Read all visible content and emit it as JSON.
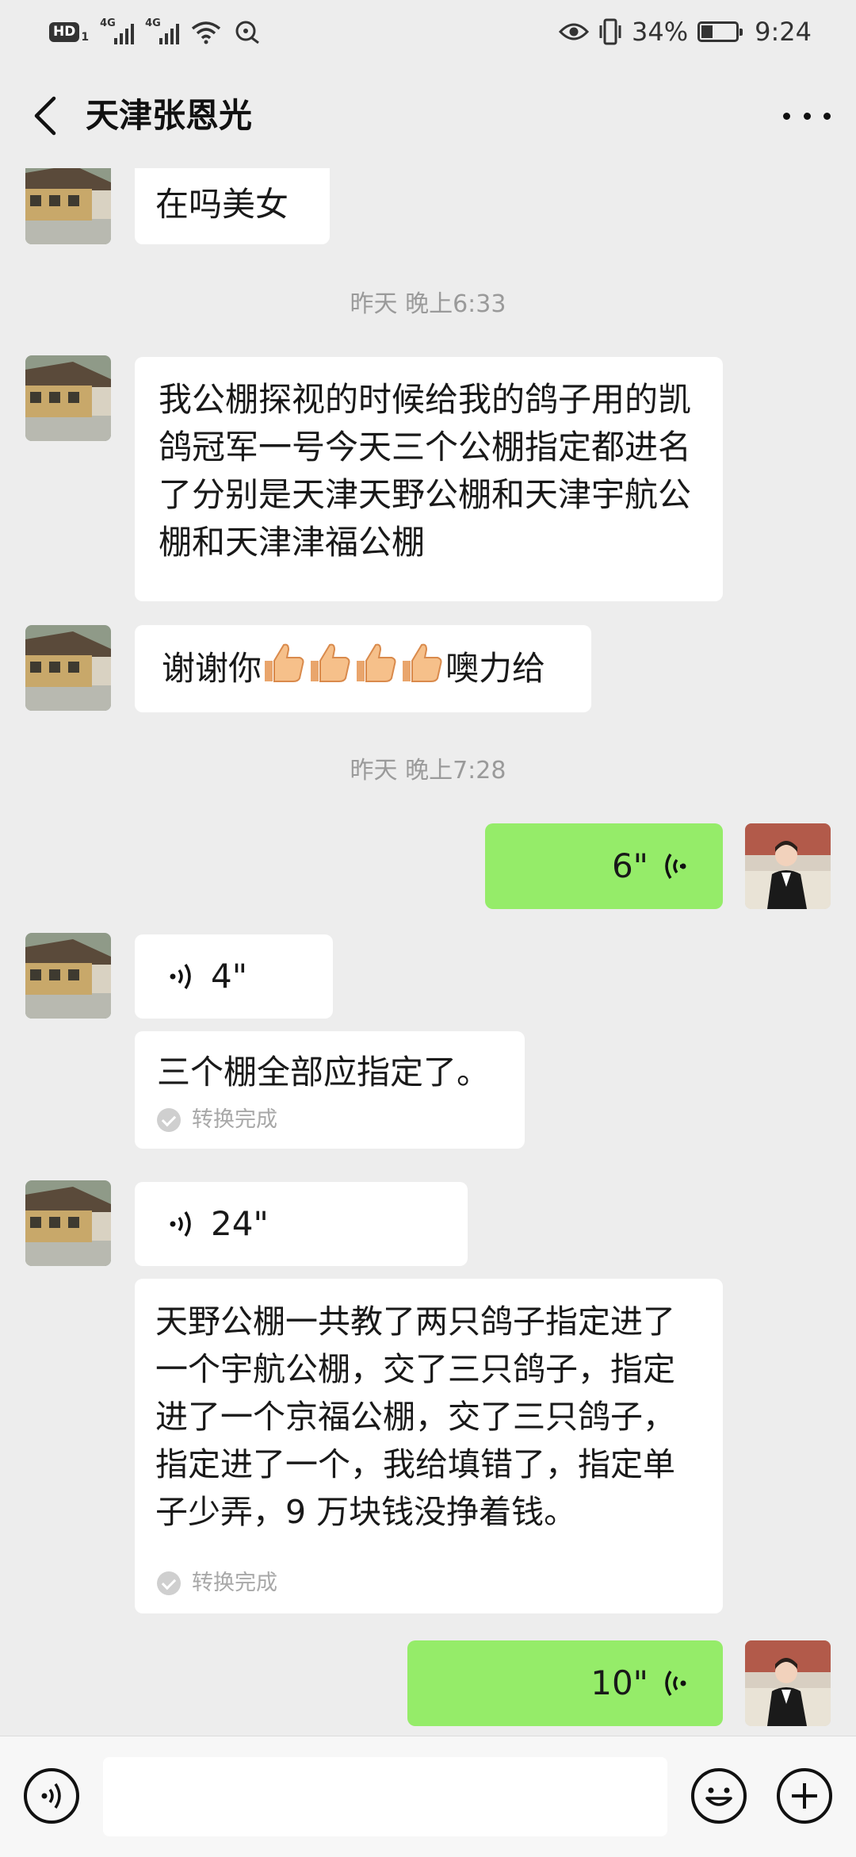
{
  "status_bar": {
    "hd": "HD",
    "sim1": "1",
    "net1": "4G",
    "net2": "4G",
    "battery": "34%",
    "battery_level": 0.34,
    "time": "9:24"
  },
  "header": {
    "title": "天津张恩光"
  },
  "messages": {
    "m1": "在吗美女",
    "ts1": "昨天 晚上6:33",
    "m2": "我公棚探视的时候给我的鸽子用的凯鸽冠军一号今天三个公棚指定都进名了分别是天津天野公棚和天津宇航公棚和天津津福公棚",
    "m3_pre": "谢谢你",
    "m3_post": "噢力给",
    "ts2": "昨天 晚上7:28",
    "v1": "6\"",
    "v2": "4\"",
    "t2": "三个棚全部应指定了。",
    "t2_status": "转换完成",
    "v3": "24\"",
    "t3": "天野公棚一共教了两只鸽子指定进了一个宇航公棚，交了三只鸽子，指定进了一个京福公棚，交了三只鸽子，指定进了一个，我给填错了，指定单子少弄，9 万块钱没挣着钱。",
    "t3_status": "转换完成",
    "v4": "10\""
  },
  "colors": {
    "background": "#ededed",
    "outgoing_bubble": "#95ec69",
    "incoming_bubble": "#ffffff"
  },
  "icons": [
    "hd-icon",
    "signal-icon",
    "wifi-icon",
    "eye-icon",
    "vibrate-icon",
    "battery-icon",
    "back-arrow-icon",
    "more-icon",
    "voice-wave-icon",
    "thumbs-up-icon",
    "check-icon",
    "voice-mode-icon",
    "emoji-icon",
    "plus-icon"
  ]
}
